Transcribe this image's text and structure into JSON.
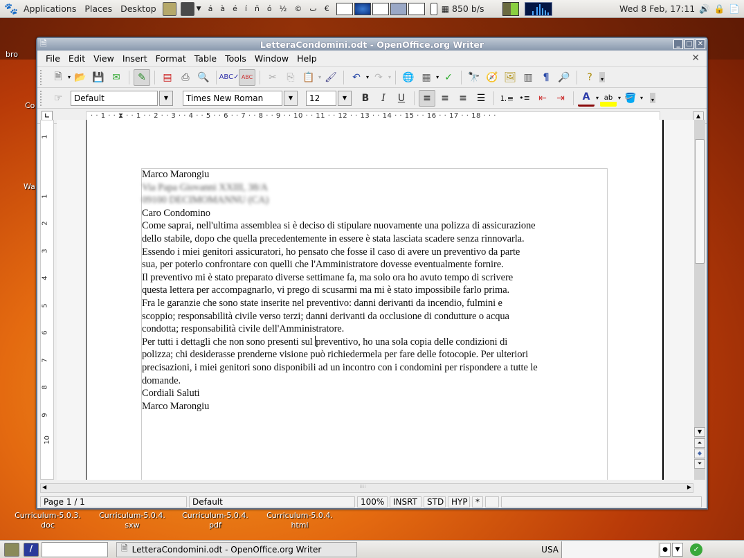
{
  "top_panel": {
    "menus": [
      "Applications",
      "Places",
      "Desktop"
    ],
    "special_chars": [
      "á",
      "à",
      "é",
      "í",
      "ñ",
      "ó",
      "½",
      "©",
      "ٮ",
      "€"
    ],
    "net_speed": "850 b/s",
    "clock": "Wed  8 Feb, 17:11",
    "icons": [
      "gnome-foot-icon",
      "file-cabinet-icon",
      "terminal-icon",
      "dropdown-arrow-icon",
      "workspace-switcher",
      "battery-icon",
      "system-monitor-graph",
      "volume-icon",
      "lock-icon",
      "clipboard-icon"
    ]
  },
  "desktop": {
    "icons": [
      {
        "label": "Curriculum-5.0.3.\ndoc"
      },
      {
        "label": "Curriculum-5.0.4.\nsxw"
      },
      {
        "label": "Curriculum-5.0.4.\npdf"
      },
      {
        "label": "Curriculum-5.0.4.\nhtml"
      }
    ],
    "partial_labels": [
      "bro",
      "Co",
      "Wa"
    ]
  },
  "window": {
    "title": "LetteraCondomini.odt - OpenOffice.org Writer",
    "menu": [
      {
        "label": "File",
        "key": "F"
      },
      {
        "label": "Edit",
        "key": "E"
      },
      {
        "label": "View",
        "key": "V"
      },
      {
        "label": "Insert",
        "key": "I"
      },
      {
        "label": "Format",
        "key": "o"
      },
      {
        "label": "Table",
        "key": "a"
      },
      {
        "label": "Tools",
        "key": "T"
      },
      {
        "label": "Window",
        "key": "W"
      },
      {
        "label": "Help",
        "key": "H"
      }
    ],
    "formatting": {
      "paragraph_style": "Default",
      "font_name": "Times New Roman",
      "font_size": "12"
    },
    "ruler_text": "· · 1 · · ⧗ · · 1 · · 2 · · 3 · · 4 · · 5 · · 6 · · 7 · · 8 · · 9 · · 10 · · 11 · · 12 · · 13 · · 14 · · 15 · · 16 · · 17 · · 18 · · ·",
    "vruler_labels": [
      "1",
      "1",
      "2",
      "3",
      "4",
      "5",
      "6",
      "7",
      "8",
      "9",
      "10"
    ],
    "document": {
      "lines": [
        "Marco Marongiu",
        "[redacted address line 1]",
        "[redacted address line 2]",
        "Caro Condomino",
        "Come saprai, nell'ultima  assemblea si è deciso di stipulare nuovamente una polizza di assicurazione",
        "dello stabile, dopo che quella precedentemente in essere è stata lasciata scadere senza rinnovarla.",
        "Essendo i miei genitori assicuratori, ho pensato che fosse il caso di avere un preventivo  da parte",
        "sua, per poterlo  confrontare con quelli  che l'Amministratore dovesse eventualmente fornire.",
        "Il preventivo mi  è stato preparato diverse settimane fa, ma solo ora ho avuto tempo di scrivere",
        "questa lettera per accompagnarlo, vi prego di scusarmi ma mi è stato impossibile farlo prima.",
        "Fra le garanzie  che sono state inserite nel preventivo:  danni derivanti da incendio, fulmini  e",
        "scoppio; responsabilità civile verso terzi; danni derivanti da occlusione  di condutture o acqua",
        "condotta; responsabilità  civile  dell'Amministratore.",
        "Per tutti i dettagli  che non sono presenti sul ",
        "polizza;  chi desiderasse prenderne visione può richiedermela per fare delle fotocopie.  Per ulteriori",
        "precisazioni,  i miei  genitori sono disponibili  ad un incontro con i condomini per rispondere a tutte le",
        "domande.",
        "Cordiali  Saluti",
        "Marco Marongiu"
      ],
      "caret_line_tail": "preventivo, ho una sola copia delle  condizioni  di"
    },
    "status": {
      "page": "Page 1 / 1",
      "style": "Default",
      "zoom": "100%",
      "insert_mode": "INSRT",
      "selection_mode": "STD",
      "hyperlink_mode": "HYP",
      "modified": "*"
    }
  },
  "taskbar": {
    "window_button": "LetteraCondomini.odt - OpenOffice.org Writer",
    "keyboard_layout": "USA"
  }
}
